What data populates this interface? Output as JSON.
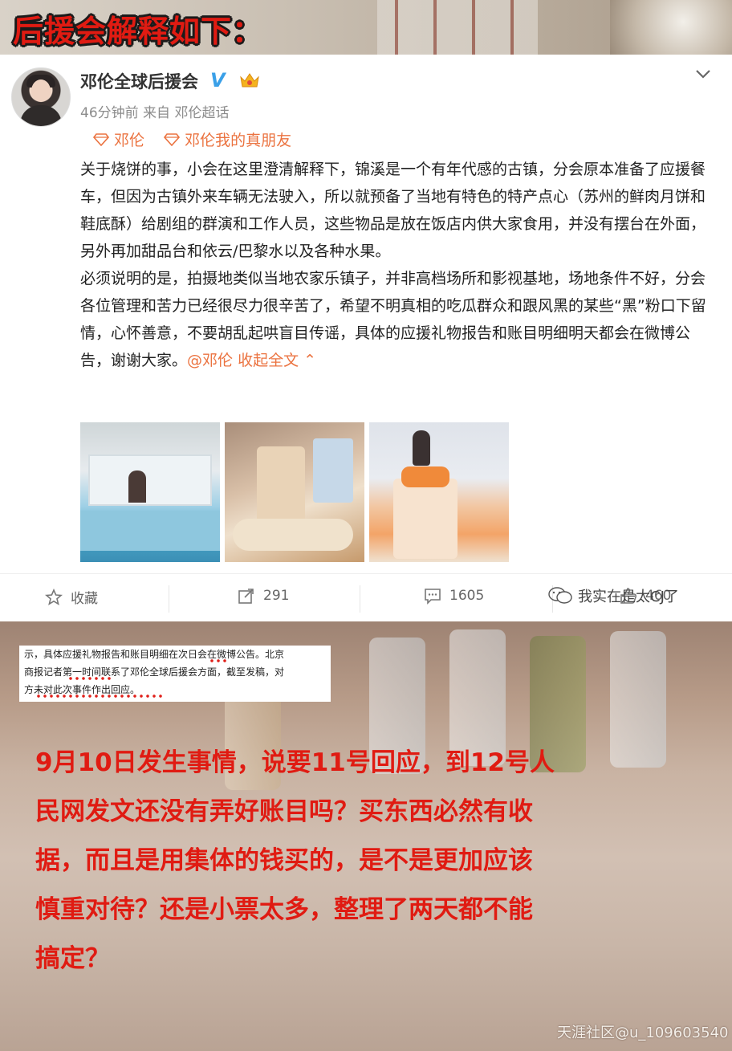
{
  "banner": {
    "title": "后援会解释如下："
  },
  "post": {
    "author": "邓伦全球后援会",
    "verified_mark": "V",
    "meta": "46分钟前 来自 邓伦超话",
    "topics": [
      "邓伦",
      "邓伦我的真朋友"
    ],
    "paragraph1": "关于烧饼的事，小会在这里澄清解释下，锦溪是一个有年代感的古镇，分会原本准备了应援餐车，但因为古镇外来车辆无法驶入，所以就预备了当地有特色的特产点心（苏州的鲜肉月饼和鞋底酥）给剧组的群演和工作人员，这些物品是放在饭店内供大家食用，并没有摆台在外面，另外再加甜品台和依云/巴黎水以及各种水果。",
    "paragraph2": "必须说明的是，拍摄地类似当地农家乐镇子，并非高档场所和影视基地，场地条件不好，分会各位管理和苦力已经很尽力很辛苦了，希望不明真相的吃瓜群众和跟风黑的某些“黑”粉口下留情，心怀善意，不要胡乱起哄盲目传谣，具体的应援礼物报告和账目明细明天都会在微博公告，谢谢大家。",
    "mention": "@邓伦",
    "collapse": "收起全文",
    "actions": {
      "favorite": "收藏",
      "repost": "291",
      "comment": "1605",
      "like": "460"
    },
    "watermark": "我实在是太CJ了"
  },
  "clipping": {
    "line1": "示，具体应援礼物报告和账目明细在次日会在微博公告。北京",
    "line2": "商报记者第一时间联系了邓伦全球后援会方面，截至发稿，对",
    "line3": "方未对此次事件作出回应。"
  },
  "comment": {
    "line1": "9月10日发生事情，说要11号回应，到12号人",
    "line2": "民网发文还没有弄好账目吗？买东西必然有收",
    "line3": "据，而且是用集体的钱买的，是不是更加应该",
    "line4": "慎重对待？还是小票太多，整理了两天都不能",
    "line5": "搞定？"
  },
  "footer_watermark": "天涯社区@u_109603540",
  "colors": {
    "accent_red": "#e01b12",
    "topic_orange": "#eb7340",
    "verified_blue": "#3aa0e8"
  }
}
